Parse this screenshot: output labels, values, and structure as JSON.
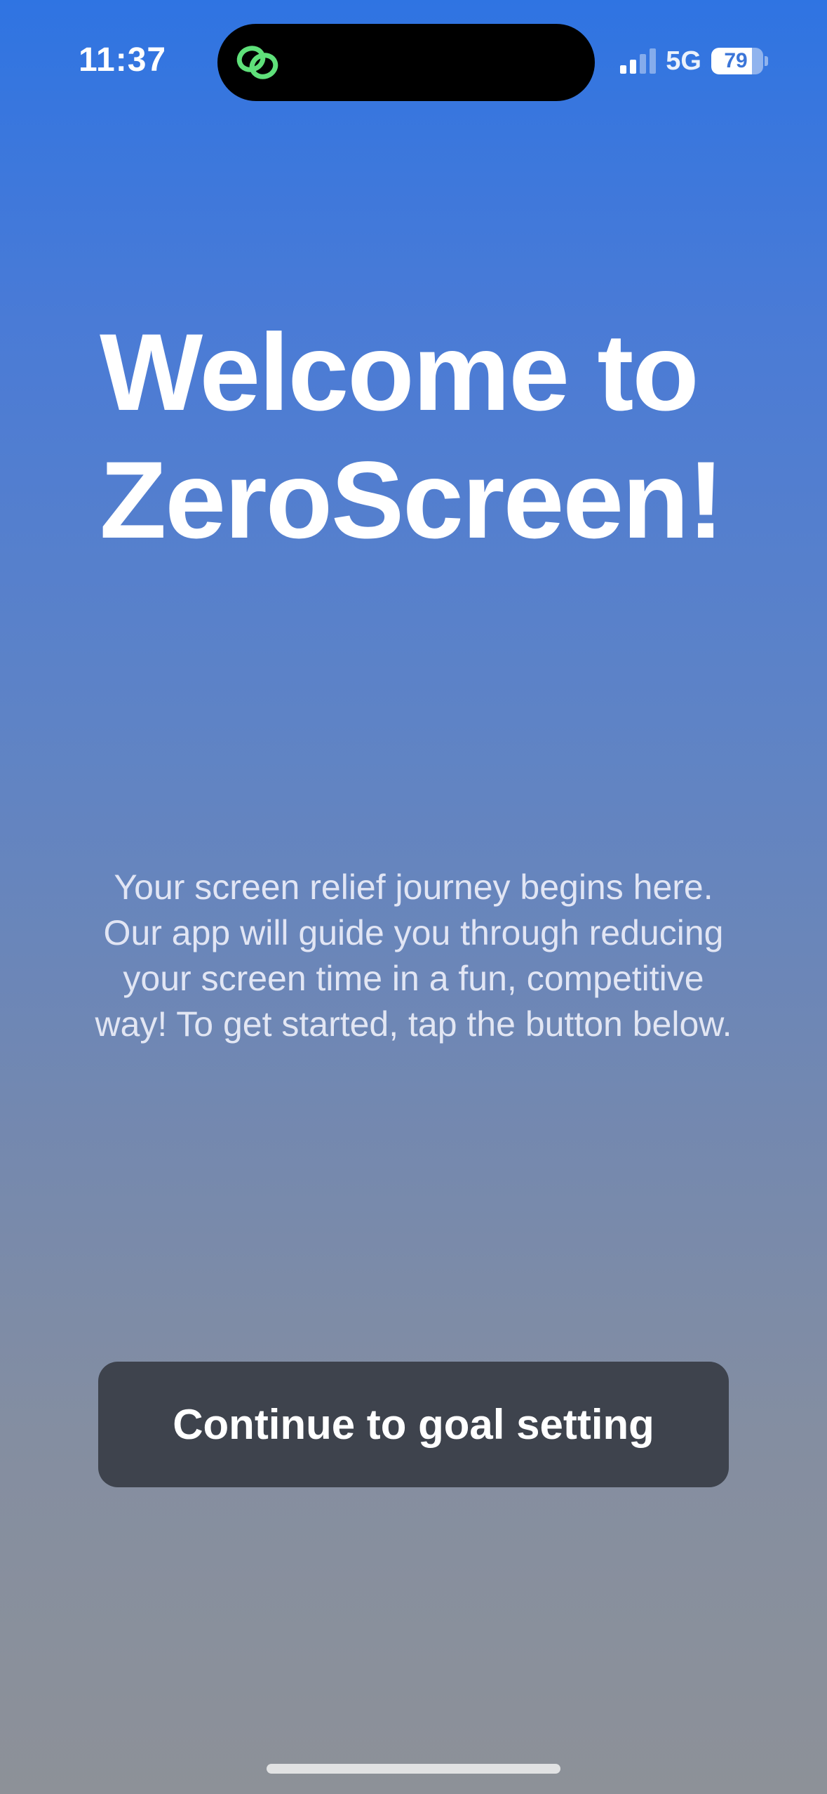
{
  "status_bar": {
    "time": "11:37",
    "network": "5G",
    "battery_level": "79",
    "battery_fraction": 0.79,
    "signal_bars_active": 2,
    "signal_bars_total": 4,
    "island_icon": "link-rings-icon",
    "island_icon_color": "#5fe07a"
  },
  "welcome": {
    "title_line1": "Welcome to",
    "title_line2": "ZeroScreen!",
    "description": "Your screen relief journey begins here. Our app will guide you through reducing your screen time in a fun, competitive way! To get started, tap the button below."
  },
  "actions": {
    "continue_label": "Continue to goal setting"
  },
  "colors": {
    "background_top": "#2f74e2",
    "background_bottom": "#8d9198",
    "button_background": "#3e434d"
  }
}
